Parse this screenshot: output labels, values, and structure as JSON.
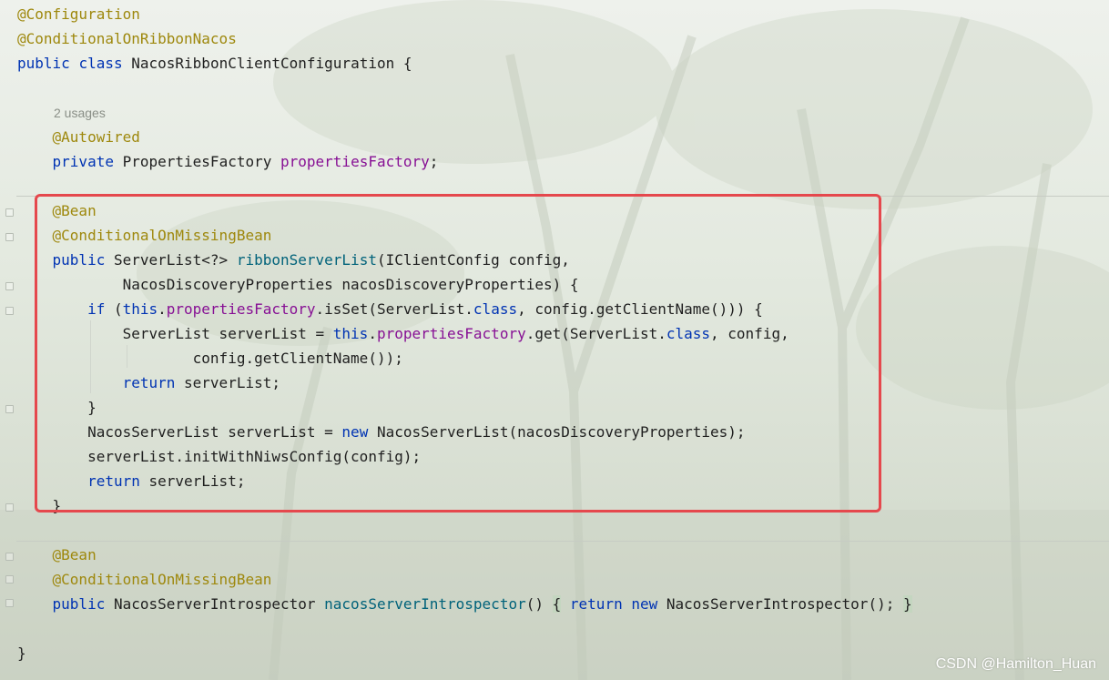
{
  "editor": {
    "usages_hint": "2 usages",
    "lines": [
      {
        "id": "l1",
        "tokens": [
          {
            "t": "@Configuration",
            "c": "ann"
          }
        ]
      },
      {
        "id": "l2",
        "tokens": [
          {
            "t": "@ConditionalOnRibbonNacos",
            "c": "ann"
          }
        ]
      },
      {
        "id": "l3",
        "tokens": [
          {
            "t": "public",
            "c": "kw"
          },
          {
            "t": " "
          },
          {
            "t": "class",
            "c": "kw"
          },
          {
            "t": " NacosRibbonClientConfiguration {"
          }
        ]
      },
      {
        "id": "l4",
        "tokens": [
          {
            "t": "    "
          },
          {
            "t": "@Autowired",
            "c": "ann"
          }
        ]
      },
      {
        "id": "l5",
        "tokens": [
          {
            "t": "    "
          },
          {
            "t": "private",
            "c": "kw"
          },
          {
            "t": " PropertiesFactory "
          },
          {
            "t": "propertiesFactory",
            "c": "fld"
          },
          {
            "t": ";"
          }
        ]
      },
      {
        "id": "l6",
        "tokens": [
          {
            "t": "    "
          },
          {
            "t": "@Bean",
            "c": "ann"
          }
        ]
      },
      {
        "id": "l7",
        "tokens": [
          {
            "t": "    "
          },
          {
            "t": "@ConditionalOnMissingBean",
            "c": "ann"
          }
        ]
      },
      {
        "id": "l8",
        "tokens": [
          {
            "t": "    "
          },
          {
            "t": "public",
            "c": "kw"
          },
          {
            "t": " ServerList<?> "
          },
          {
            "t": "ribbonServerList",
            "c": "mth"
          },
          {
            "t": "(IClientConfig config,"
          }
        ]
      },
      {
        "id": "l9",
        "tokens": [
          {
            "t": "            NacosDiscoveryProperties nacosDiscoveryProperties) {"
          }
        ]
      },
      {
        "id": "l10",
        "tokens": [
          {
            "t": "        "
          },
          {
            "t": "if",
            "c": "kw"
          },
          {
            "t": " ("
          },
          {
            "t": "this",
            "c": "kw"
          },
          {
            "t": "."
          },
          {
            "t": "propertiesFactory",
            "c": "fld"
          },
          {
            "t": ".isSet(ServerList."
          },
          {
            "t": "class",
            "c": "kw"
          },
          {
            "t": ", config.getClientName())) {"
          }
        ]
      },
      {
        "id": "l11",
        "tokens": [
          {
            "t": "            ServerList serverList = "
          },
          {
            "t": "this",
            "c": "kw"
          },
          {
            "t": "."
          },
          {
            "t": "propertiesFactory",
            "c": "fld"
          },
          {
            "t": ".get(ServerList."
          },
          {
            "t": "class",
            "c": "kw"
          },
          {
            "t": ", config,"
          }
        ]
      },
      {
        "id": "l12",
        "tokens": [
          {
            "t": "                    config.getClientName());"
          }
        ]
      },
      {
        "id": "l13",
        "tokens": [
          {
            "t": "            "
          },
          {
            "t": "return",
            "c": "kw"
          },
          {
            "t": " serverList;"
          }
        ]
      },
      {
        "id": "l14",
        "tokens": [
          {
            "t": "        }"
          }
        ]
      },
      {
        "id": "l15",
        "tokens": [
          {
            "t": "        NacosServerList serverList = "
          },
          {
            "t": "new",
            "c": "kw"
          },
          {
            "t": " NacosServerList(nacosDiscoveryProperties);"
          }
        ]
      },
      {
        "id": "l16",
        "tokens": [
          {
            "t": "        serverList.initWithNiwsConfig(config);"
          }
        ]
      },
      {
        "id": "l17",
        "tokens": [
          {
            "t": "        "
          },
          {
            "t": "return",
            "c": "kw"
          },
          {
            "t": " serverList;"
          }
        ]
      },
      {
        "id": "l18",
        "tokens": [
          {
            "t": "    }"
          }
        ]
      },
      {
        "id": "l19",
        "tokens": [
          {
            "t": "    "
          },
          {
            "t": "@Bean",
            "c": "ann"
          }
        ]
      },
      {
        "id": "l20",
        "tokens": [
          {
            "t": "    "
          },
          {
            "t": "@ConditionalOnMissingBean",
            "c": "ann"
          }
        ]
      },
      {
        "id": "l21",
        "tokens": [
          {
            "t": "    "
          },
          {
            "t": "public",
            "c": "kw"
          },
          {
            "t": " NacosServerIntrospector "
          },
          {
            "t": "nacosServerIntrospector",
            "c": "mth"
          },
          {
            "t": "() "
          },
          {
            "t": "{",
            "c": "brace"
          },
          {
            "t": " "
          },
          {
            "t": "return",
            "c": "kw"
          },
          {
            "t": " "
          },
          {
            "t": "new",
            "c": "kw"
          },
          {
            "t": " NacosServerIntrospector(); "
          },
          {
            "t": "}",
            "c": "brace"
          }
        ]
      },
      {
        "id": "l22",
        "tokens": [
          {
            "t": "}"
          }
        ]
      }
    ]
  },
  "watermark": "CSDN @Hamilton_Huan",
  "colors": {
    "annotation": "#9e880d",
    "keyword": "#0033b3",
    "field": "#871094",
    "method": "#00627a",
    "highlight_box": "#e5484d"
  }
}
